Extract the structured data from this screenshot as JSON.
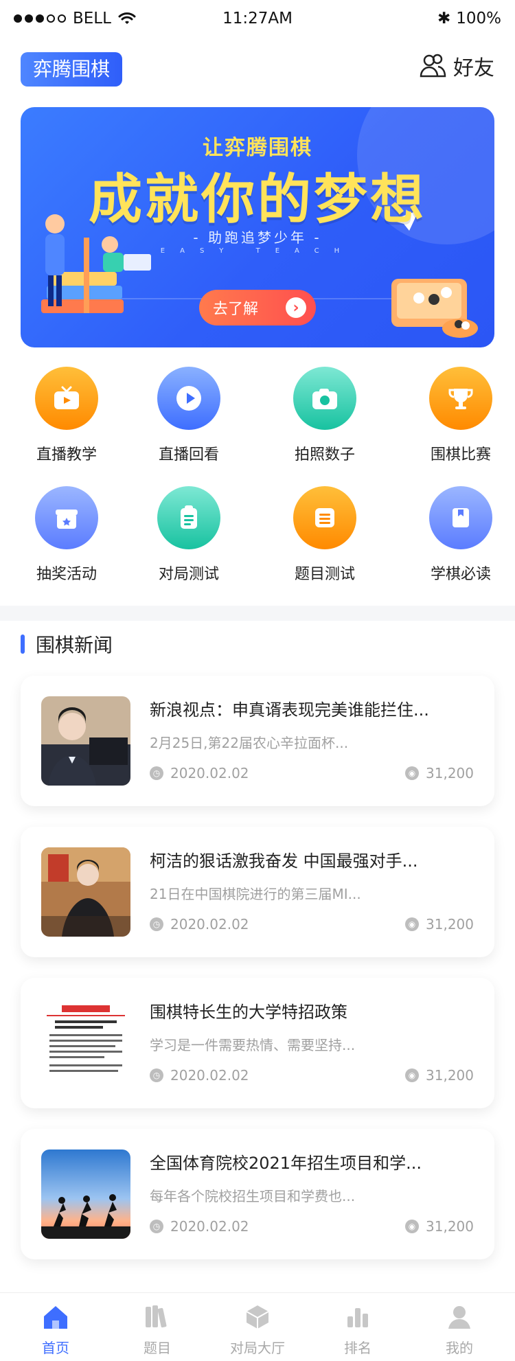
{
  "status": {
    "carrier": "BELL",
    "time": "11:27AM",
    "battery": "100%"
  },
  "header": {
    "brand": "弈腾围棋",
    "friends": "好友"
  },
  "banner": {
    "sub": "让弈腾围棋",
    "title": "成就你的梦想",
    "tag": "- 助跑追梦少年 -",
    "tag_en": "EASY TEACH",
    "button": "去了解"
  },
  "grid": [
    {
      "label": "直播教学",
      "icon": "tv-icon",
      "color": "orange"
    },
    {
      "label": "直播回看",
      "icon": "play-icon",
      "color": "blue"
    },
    {
      "label": "拍照数子",
      "icon": "camera-icon",
      "color": "teal"
    },
    {
      "label": "围棋比赛",
      "icon": "trophy-icon",
      "color": "orange"
    },
    {
      "label": "抽奖活动",
      "icon": "gift-icon",
      "color": "purple"
    },
    {
      "label": "对局测试",
      "icon": "clipboard-icon",
      "color": "teal"
    },
    {
      "label": "题目测试",
      "icon": "list-icon",
      "color": "orange"
    },
    {
      "label": "学棋必读",
      "icon": "book-icon",
      "color": "purple"
    }
  ],
  "news": {
    "title": "围棋新闻",
    "items": [
      {
        "title": "新浪视点：申真谞表现完美谁能拦住...",
        "excerpt": "2月25日,第22届农心辛拉面杯...",
        "date": "2020.02.02",
        "views": "31,200"
      },
      {
        "title": "柯洁的狠话激我奋发 中国最强对手...",
        "excerpt": "21日在中国棋院进行的第三届MI...",
        "date": "2020.02.02",
        "views": "31,200"
      },
      {
        "title": "围棋特长生的大学特招政策",
        "excerpt": "学习是一件需要热情、需要坚持...",
        "date": "2020.02.02",
        "views": "31,200"
      },
      {
        "title": "全国体育院校2021年招生项目和学...",
        "excerpt": "每年各个院校招生项目和学费也...",
        "date": "2020.02.02",
        "views": "31,200"
      }
    ]
  },
  "tabs": [
    {
      "label": "首页",
      "icon": "home-icon",
      "active": true
    },
    {
      "label": "题目",
      "icon": "books-icon",
      "active": false
    },
    {
      "label": "对局大厅",
      "icon": "cube-icon",
      "active": false
    },
    {
      "label": "排名",
      "icon": "chart-icon",
      "active": false
    },
    {
      "label": "我的",
      "icon": "user-icon",
      "active": false
    }
  ]
}
